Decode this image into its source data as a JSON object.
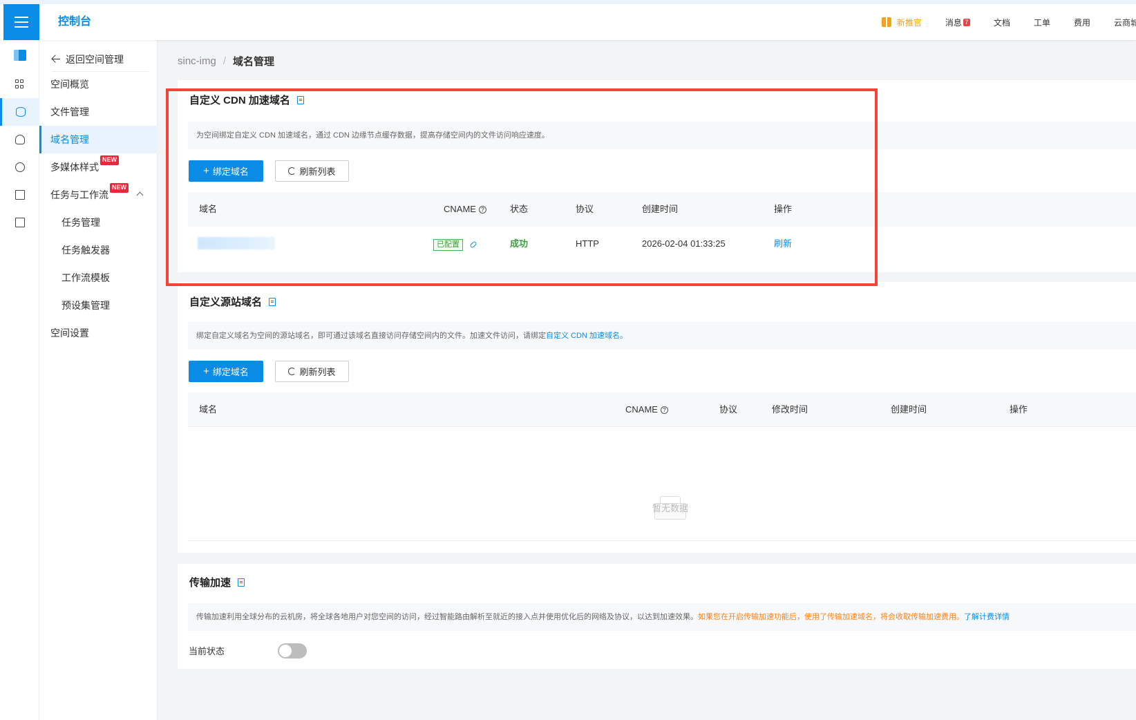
{
  "header": {
    "console_title": "控制台",
    "items": {
      "new_gift": "新推官",
      "messages": "消息",
      "messages_count": "7",
      "docs": "文档",
      "tickets": "工单",
      "billing": "费用",
      "cloud_market": "云商城"
    }
  },
  "rail": {
    "icons": [
      "logo-icon",
      "grid-icon",
      "database-icon",
      "cloud-icon",
      "pie-chart-icon",
      "file-search-icon",
      "transfer-icon"
    ]
  },
  "sidemenu": {
    "back": "返回空间管理",
    "overview": "空间概览",
    "file_mgmt": "文件管理",
    "domain_mgmt": "域名管理",
    "media_style": "多媒体样式",
    "tasks_workflow": "任务与工作流",
    "task_mgmt": "任务管理",
    "task_trigger": "任务触发器",
    "workflow_template": "工作流模板",
    "preset_mgmt": "预设集管理",
    "space_settings": "空间设置",
    "new_badge": "NEW"
  },
  "breadcrumb": {
    "bucket": "sinc-img",
    "separator": "/",
    "current": "域名管理"
  },
  "cdn": {
    "title": "自定义 CDN 加速域名",
    "desc": "为空间绑定自定义 CDN 加速域名，通过 CDN 边缘节点缓存数据，提高存储空间内的文件访问响应速度。",
    "bind_btn": "绑定域名",
    "refresh_btn": "刷新列表",
    "columns": {
      "domain": "域名",
      "cname": "CNAME",
      "status": "状态",
      "protocol": "协议",
      "created": "创建时间",
      "actions": "操作"
    },
    "rows": [
      {
        "cname_tag": "已配置",
        "status": "成功",
        "protocol": "HTTP",
        "created": "2026-02-04 01:33:25",
        "action": "刷新"
      }
    ]
  },
  "origin": {
    "title": "自定义源站域名",
    "desc_prefix": "绑定自定义域名为空间的源站域名，即可通过该域名直接访问存储空间内的文件。加速文件访问，请绑定",
    "desc_link": "自定义 CDN 加速域名。",
    "bind_btn": "绑定域名",
    "refresh_btn": "刷新列表",
    "columns": {
      "domain": "域名",
      "cname": "CNAME",
      "protocol": "协议",
      "modified": "修改时间",
      "created": "创建时间",
      "actions": "操作"
    },
    "empty_text": "暂无数据"
  },
  "transfer": {
    "title": "传输加速",
    "desc_normal": "传输加速利用全球分布的云机房，将全球各地用户对您空间的访问，经过智能路由解析至就近的接入点并使用优化后的网络及协议，以达到加速效果。",
    "desc_warn": "如果您在开启传输加速功能后，使用了传输加速域名，将会收取传输加速费用。",
    "desc_link": "了解计费详情",
    "status_label": "当前状态",
    "enabled": false
  },
  "colors": {
    "primary": "#0a8ce6",
    "success": "#3f9d3f",
    "warn": "#f5841f",
    "highlight": "#f44336"
  }
}
